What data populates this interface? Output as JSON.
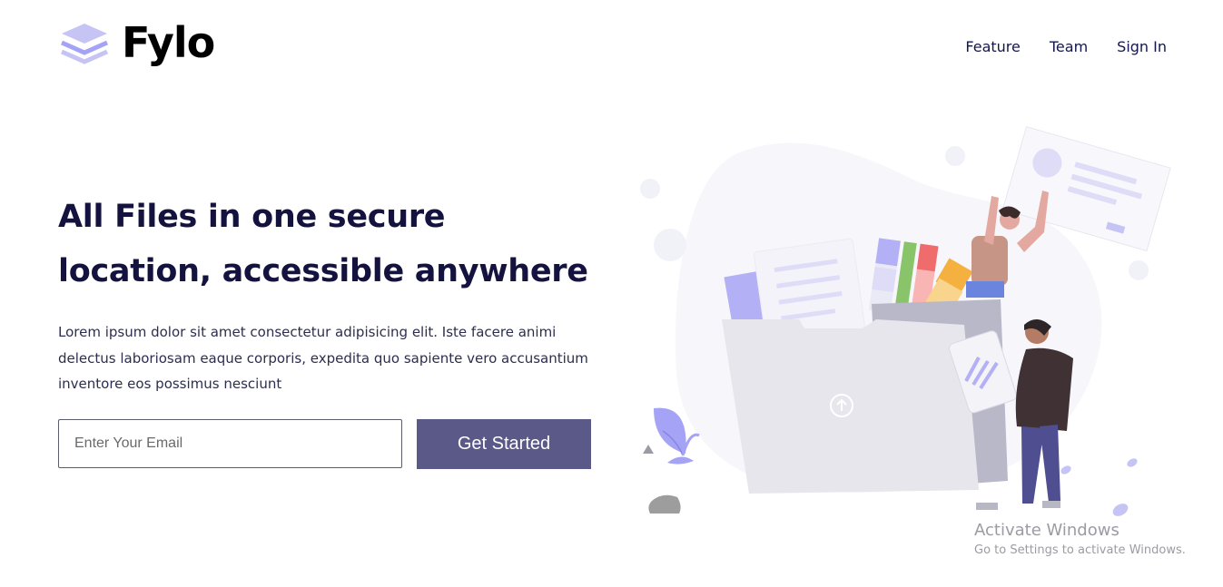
{
  "brand": {
    "name": "Fylo",
    "icon": "layers-icon",
    "accent_color": "#a5a3f5"
  },
  "nav": {
    "items": [
      "Feature",
      "Team",
      "Sign In"
    ]
  },
  "hero": {
    "title_line1": "All Files in one secure",
    "title_line2": "location, accessible anywhere",
    "body": "Lorem ipsum dolor sit amet consectetur adipisicing elit. Iste facere animi delectus laboriosam eaque corporis, expedita quo sapiente vero accusantium inventore eos possimus nesciunt",
    "email_placeholder": "Enter Your Email",
    "email_value": "",
    "cta_label": "Get Started",
    "cta_color": "#5a5988"
  },
  "illustration": {
    "name": "files-illustration",
    "upload_icon": "upload-arrow-icon"
  },
  "watermark": {
    "title": "Activate Windows",
    "subtitle": "Go to Settings to activate Windows."
  }
}
